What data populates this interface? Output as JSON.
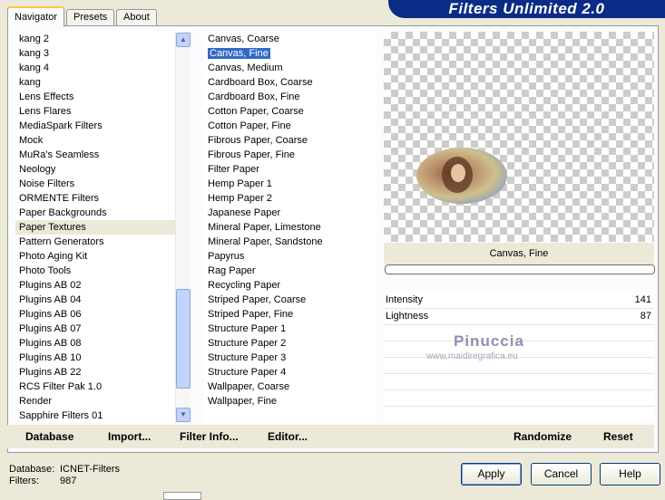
{
  "window": {
    "title": "Filters Unlimited 2.0"
  },
  "tabs": [
    "Navigator",
    "Presets",
    "About"
  ],
  "categories": [
    "kang 2",
    "kang 3",
    "kang 4",
    "kang",
    "Lens Effects",
    "Lens Flares",
    "MediaSpark Filters",
    "Mock",
    "MuRa's Seamless",
    "Neology",
    "Noise Filters",
    "ORMENTE Filters",
    "Paper Backgrounds",
    "Paper Textures",
    "Pattern Generators",
    "Photo Aging Kit",
    "Photo Tools",
    "Plugins AB 02",
    "Plugins AB 04",
    "Plugins AB 06",
    "Plugins AB 07",
    "Plugins AB 08",
    "Plugins AB 10",
    "Plugins AB 22",
    "RCS Filter Pak 1.0",
    "Render",
    "Sapphire Filters 01"
  ],
  "selected_category": "Paper Textures",
  "filters": [
    "Canvas, Coarse",
    "Canvas, Fine",
    "Canvas, Medium",
    "Cardboard Box, Coarse",
    "Cardboard Box, Fine",
    "Cotton Paper, Coarse",
    "Cotton Paper, Fine",
    "Fibrous Paper, Coarse",
    "Fibrous Paper, Fine",
    "Filter Paper",
    "Hemp Paper 1",
    "Hemp Paper 2",
    "Japanese Paper",
    "Mineral Paper, Limestone",
    "Mineral Paper, Sandstone",
    "Papyrus",
    "Rag Paper",
    "Recycling Paper",
    "Striped Paper, Coarse",
    "Striped Paper, Fine",
    "Structure Paper 1",
    "Structure Paper 2",
    "Structure Paper 3",
    "Structure Paper 4",
    "Wallpaper, Coarse",
    "Wallpaper, Fine"
  ],
  "selected_filter": "Canvas, Fine",
  "preview": {
    "filter_name": "Canvas, Fine"
  },
  "params": [
    {
      "label": "Intensity",
      "value": "141"
    },
    {
      "label": "Lightness",
      "value": "87"
    }
  ],
  "watermark": {
    "name": "Pinuccia",
    "url": "www.maidiregrafica.eu"
  },
  "toolbar": {
    "database": "Database",
    "import": "Import...",
    "filter_info": "Filter Info...",
    "editor": "Editor..."
  },
  "toolbar2": {
    "randomize": "Randomize",
    "reset": "Reset"
  },
  "status": {
    "database_label": "Database:",
    "database_value": "ICNET-Filters",
    "filters_label": "Filters:",
    "filters_value": "987"
  },
  "buttons": {
    "apply": "Apply",
    "cancel": "Cancel",
    "help": "Help"
  },
  "colors": {
    "banner": "#0a2c86",
    "selection": "#316ac5",
    "tab_accent": "#ffc83c"
  }
}
